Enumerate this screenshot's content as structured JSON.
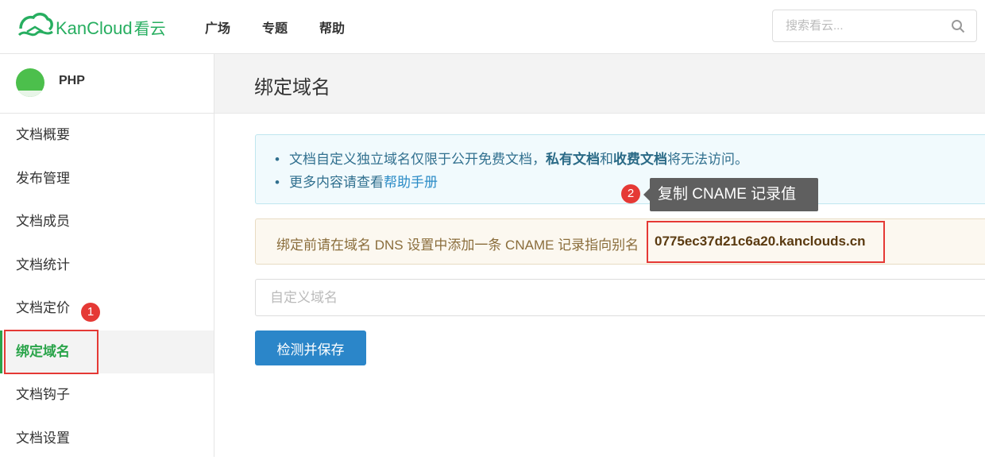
{
  "header": {
    "logo_text": "KanCloud",
    "logo_cn": "看云",
    "nav": [
      "广场",
      "专题",
      "帮助"
    ],
    "search_placeholder": "搜索看云..."
  },
  "sidebar": {
    "title": "PHP",
    "items": [
      {
        "label": "文档概要"
      },
      {
        "label": "发布管理"
      },
      {
        "label": "文档成员"
      },
      {
        "label": "文档统计"
      },
      {
        "label": "文档定价"
      },
      {
        "label": "绑定域名",
        "active": true
      },
      {
        "label": "文档钩子"
      },
      {
        "label": "文档设置"
      }
    ]
  },
  "main": {
    "title": "绑定域名",
    "info": {
      "line1_pre": "文档自定义独立域名仅限于公开免费文档，",
      "line1_b1": "私有文档",
      "line1_mid": "和",
      "line1_b2": "收费文档",
      "line1_post": "将无法访问。",
      "line2_pre": "更多内容请查看",
      "line2_link": "帮助手册",
      "bullet": "•"
    },
    "warn_text": "绑定前请在域名 DNS 设置中添加一条 CNAME 记录指向别名",
    "cname_value": "0775ec37d21c6a20.kanclouds.cn",
    "domain_placeholder": "自定义域名",
    "save_label": "检测并保存"
  },
  "annotations": {
    "badge1": "1",
    "badge2": "2",
    "tooltip": "复制 CNAME 记录值",
    "color": "#e53935"
  }
}
